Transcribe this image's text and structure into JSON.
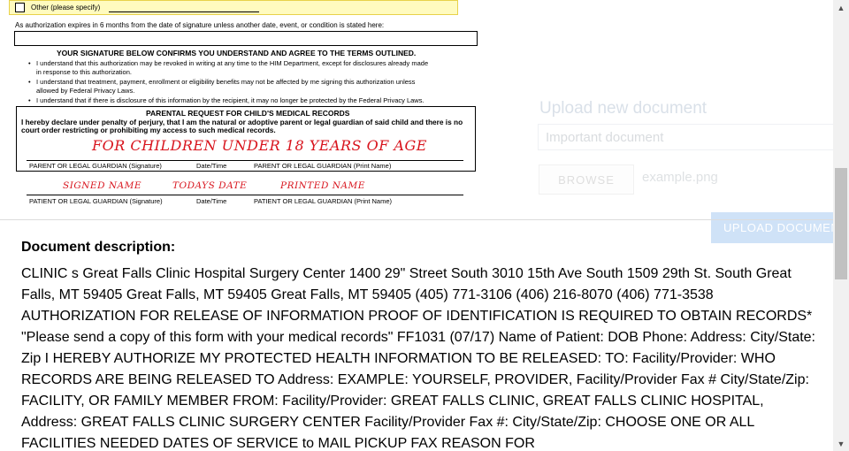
{
  "document_image": {
    "other_label": "Other (please specify)",
    "expire_note": "As authorization expires in 6 months from the date of signature unless another date, event, or condition is stated here:",
    "signature_header": "YOUR SIGNATURE BELOW CONFIRMS YOU UNDERSTAND AND AGREE TO THE TERMS OUTLINED.",
    "bullets": [
      "I understand that this authorization may be revoked in writing at any time to the HIM Department, except for disclosures already made",
      "in response to this authorization.",
      "I understand that treatment, payment, enrollment or eligibility benefits may not be affected by me signing this authorization unless",
      "allowed by Federal Privacy Laws.",
      "I understand that if there is disclosure of this information by the recipient, it may no longer be protected by the Federal Privacy Laws."
    ],
    "parental_title": "PARENTAL REQUEST FOR CHILD'S MEDICAL RECORDS",
    "declaration_1": "I hereby declare under penalty of perjury, that I am the natural or adoptive parent or legal guardian of said child and there is no",
    "declaration_2": "court order restricting or prohibiting my access to such medical records.",
    "handwritten_children": "FOR CHILDREN UNDER 18 YEARS OF AGE",
    "parent_sig_caption": "PARENT OR LEGAL GUARDIAN (Signature)",
    "date_time_caption": "Date/Time",
    "parent_print_caption": "PARENT OR LEGAL GUARDIAN (Print Name)",
    "handwritten_signed": "SIGNED NAME",
    "handwritten_date": "TODAYS DATE",
    "handwritten_printed": "PRINTED NAME",
    "patient_sig_caption": "PATIENT OR LEGAL GUARDIAN (Signature)",
    "patient_print_caption": "PATIENT OR LEGAL GUARDIAN (Print Name)"
  },
  "upload": {
    "title": "Upload new document",
    "name_value": "Important document",
    "browse_label": "BROWSE",
    "file_name": "example.png",
    "upload_label": "UPLOAD DOCUMENT"
  },
  "description": {
    "heading": "Document description:",
    "body": "CLINIC s Great Falls Clinic Hospital Surgery Center 1400 29\" Street South 3010 15th Ave South 1509 29th St. South Great Falls, MT 59405 Great Falls, MT 59405 Great Falls, MT 59405 (405) 771-3106 (406) 216-8070 (406) 771-3538 AUTHORIZATION FOR RELEASE OF INFORMATION PROOF OF IDENTIFICATION IS REQUIRED TO OBTAIN RECORDS* \"Please send a copy of this form with your medical records\" FF1031 (07/17) Name of Patient: DOB Phone: Address: City/State: Zip I HEREBY AUTHORIZE MY PROTECTED HEALTH INFORMATION TO BE RELEASED: TO: Facility/Provider: WHO RECORDS ARE BEING RELEASED TO Address: EXAMPLE: YOURSELF, PROVIDER, Facility/Provider Fax # City/State/Zip: FACILITY, OR FAMILY MEMBER FROM: Facility/Provider: GREAT FALLS CLINIC, GREAT FALLS CLINIC HOSPITAL, Address: GREAT FALLS CLINIC SURGERY CENTER Facility/Provider Fax #: City/State/Zip: CHOOSE ONE OR ALL FACILITIES NEEDED DATES OF SERVICE to MAIL PICKUP FAX REASON FOR"
  },
  "scrollbar": {
    "up_icon": "▲",
    "down_icon": "▼"
  }
}
